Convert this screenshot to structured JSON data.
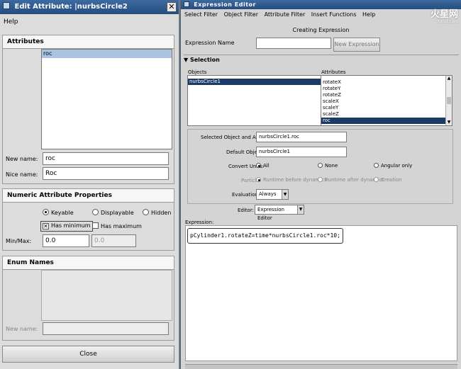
{
  "edit_attribute": {
    "title": "Edit Attribute: |nurbsCircle2",
    "close_glyph": "✕",
    "menu": {
      "help": "Help"
    },
    "attributes": {
      "header": "Attributes",
      "list": [
        "roc"
      ],
      "new_name_label": "New name:",
      "new_name_value": "roc",
      "nice_name_label": "Nice name:",
      "nice_name_value": "Roc"
    },
    "numeric": {
      "header": "Numeric Attribute Properties",
      "keyable": "Keyable",
      "displayable": "Displayable",
      "hidden": "Hidden",
      "has_minimum": "Has minimum",
      "has_maximum": "Has maximum",
      "minmax_label": "Min/Max:",
      "min_value": "0.0",
      "max_value": "0.0"
    },
    "enum": {
      "header": "Enum Names",
      "new_name_label": "New name:"
    },
    "close_button": "Close"
  },
  "expression_editor": {
    "title": "Expression Editor",
    "brand": {
      "name": "火星网",
      "url": "hxsd.com"
    },
    "menu": [
      "Select Filter",
      "Object Filter",
      "Attribute Filter",
      "Insert Functions",
      "Help"
    ],
    "mode_title": "Creating Expression",
    "expression_name_label": "Expression Name",
    "expression_name_value": "",
    "new_expression_button": "New Expression",
    "selection_header": "Selection",
    "objects_label": "Objects",
    "objects": [
      "nurbsCircle1"
    ],
    "attributes_label": "Attributes",
    "attributes": [
      "rotateX",
      "rotateY",
      "rotateZ",
      "scaleX",
      "scaleY",
      "scaleZ",
      "roc"
    ],
    "selected_attr_label": "Selected Object and Attribute:",
    "selected_attr_value": "nurbsCircle1.roc",
    "default_object_label": "Default Object:",
    "default_object_value": "nurbsCircle1",
    "convert_units_label": "Convert Units:",
    "unit_all": "All",
    "unit_none": "None",
    "unit_angular": "Angular only",
    "particle_label": "Particle:",
    "particle_before": "Runtime before dynamics",
    "particle_after": "Runtime after dynamics",
    "particle_creation": "Creation",
    "evaluation_label": "Evaluation:",
    "evaluation_value": "Always",
    "editor_label": "Editor:",
    "editor_value": "Expression Editor",
    "expression_label": "Expression:",
    "expression_text": "pCylinder1.rotateZ=time*nurbsCircle1.roc*10;"
  }
}
